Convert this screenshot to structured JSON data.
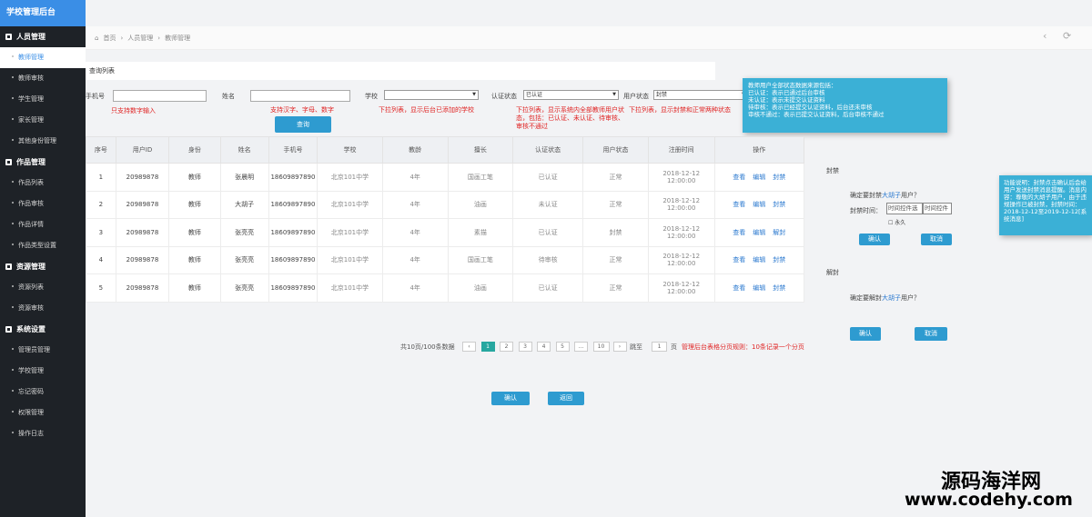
{
  "sidebar": {
    "title": "学校管理后台",
    "sections": [
      {
        "label": "人员管理",
        "items": [
          "教师管理",
          "教师审核",
          "学生管理",
          "家长管理",
          "其他身份管理"
        ]
      },
      {
        "label": "作品管理",
        "items": [
          "作品列表",
          "作品审核",
          "作品详情",
          "作品类型设置"
        ]
      },
      {
        "label": "资源管理",
        "items": [
          "资源列表",
          "资源审核"
        ]
      },
      {
        "label": "系统设置",
        "items": [
          "管理员管理",
          "学校管理",
          "忘记密码",
          "权限管理",
          "操作日志"
        ]
      }
    ]
  },
  "breadcrumb": {
    "home": "首页",
    "level1": "人员管理",
    "level2": "教师管理"
  },
  "list_title": "查询列表",
  "filters": {
    "phone_label": "手机号",
    "name_label": "姓名",
    "school_label": "学校",
    "auth_label": "认证状态",
    "auth_value": "已认证",
    "user_state_label": "用户状态",
    "user_state_value": "封禁",
    "query_button": "查询",
    "notes": {
      "phone": "只支持数字输入",
      "name": "支持汉字、字母、数字",
      "school": "下拉列表，显示后台已添加的学校",
      "auth": "下拉列表，显示系统内全部教师用户状态，包括：已认证、未认证、待审核、审核不通过",
      "user_state": "下拉列表，显示封禁和正常两种状态"
    }
  },
  "info_note": [
    "教师用户全部状态数据来源包括：",
    "已认证：表示已通过后台审核",
    "未认证：表示未提交认证资料",
    "待审核：表示已经提交认证资料，后台还未审核",
    "审核不通过：表示已提交认证资料，后台审核不通过"
  ],
  "table": {
    "headers": [
      "序号",
      "用户ID",
      "身份",
      "姓名",
      "手机号",
      "学校",
      "教龄",
      "擅长",
      "认证状态",
      "用户状态",
      "注册时间",
      "操作"
    ],
    "rows": [
      {
        "no": "1",
        "uid": "20989878",
        "role": "教师",
        "name": "张晨明",
        "phone": "18609897890",
        "school": "北京101中学",
        "years": "4年",
        "skill": "国画工笔",
        "auth": "已认证",
        "state": "正常",
        "time": "2018-12-12 12:00:00",
        "ops": [
          "查看",
          "编辑",
          "封禁"
        ]
      },
      {
        "no": "2",
        "uid": "20989878",
        "role": "教师",
        "name": "大胡子",
        "phone": "18609897890",
        "school": "北京101中学",
        "years": "4年",
        "skill": "油画",
        "auth": "未认证",
        "state": "正常",
        "time": "2018-12-12 12:00:00",
        "ops": [
          "查看",
          "编辑",
          "封禁"
        ]
      },
      {
        "no": "3",
        "uid": "20989878",
        "role": "教师",
        "name": "张亮亮",
        "phone": "18609897890",
        "school": "北京101中学",
        "years": "4年",
        "skill": "素描",
        "auth": "已认证",
        "state": "封禁",
        "time": "2018-12-12 12:00:00",
        "ops": [
          "查看",
          "编辑",
          "解封"
        ]
      },
      {
        "no": "4",
        "uid": "20989878",
        "role": "教师",
        "name": "张亮亮",
        "phone": "18609897890",
        "school": "北京101中学",
        "years": "4年",
        "skill": "国画工笔",
        "auth": "待审核",
        "state": "正常",
        "time": "2018-12-12 12:00:00",
        "ops": [
          "查看",
          "编辑",
          "封禁"
        ]
      },
      {
        "no": "5",
        "uid": "20989878",
        "role": "教师",
        "name": "张亮亮",
        "phone": "18609897890",
        "school": "北京101中学",
        "years": "4年",
        "skill": "油画",
        "auth": "已认证",
        "state": "正常",
        "time": "2018-12-12 12:00:00",
        "ops": [
          "查看",
          "编辑",
          "封禁"
        ]
      }
    ]
  },
  "pager": {
    "summary": "共10页/100条数据",
    "prev": "‹",
    "pages": [
      "1",
      "2",
      "3",
      "4",
      "5",
      "...",
      "10"
    ],
    "next": "›",
    "jump_label": "跳至",
    "jump_value": "1",
    "unit": "页",
    "rule": "管理后台表格分页规则：10条记录一个分页"
  },
  "footer": {
    "confirm": "确认",
    "back": "返回"
  },
  "ban_dialog": {
    "title": "封禁",
    "question_pre": "确定要封禁",
    "question_name": "大胡子",
    "question_post": "用户？",
    "time_label": "封禁时间：",
    "start": "时间控件选",
    "end": "时间控件",
    "permanent": "永久",
    "confirm": "确认",
    "cancel": "取消"
  },
  "ban_note": "功能说明：封禁点击确认后会给用户发送封禁消息提醒。消息内容：尊敬的大胡子用户，由于违规操作已被封禁，封禁时间：2018-12-12至2019-12-12[系统消息]",
  "unban_dialog": {
    "title": "解封",
    "question_pre": "确定要解封",
    "question_name": "大胡子",
    "question_post": "用户？",
    "confirm": "确认",
    "cancel": "取消"
  },
  "watermark": {
    "line1": "源码海洋网",
    "line2": "www.codehy.com"
  }
}
